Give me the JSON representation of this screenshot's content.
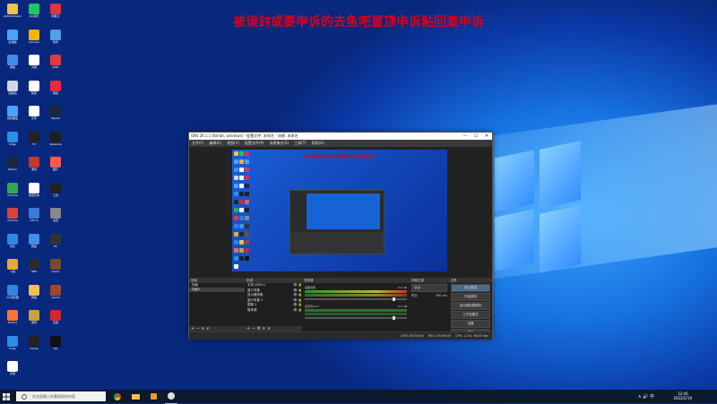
{
  "desktop": {
    "banner_text": "被误封或要申诉的去鱼吧置顶申诉贴回复申诉"
  },
  "desktop_icons": [
    {
      "label": "Administrator",
      "color": "#f2c14e"
    },
    {
      "label": "QQ音乐",
      "color": "#1ec760"
    },
    {
      "label": "网易云",
      "color": "#d9363e"
    },
    {
      "label": "此电脑",
      "color": "#4aa3ff"
    },
    {
      "label": "Chrome",
      "color": "#f4b400"
    },
    {
      "label": "软件",
      "color": "#53a0e8"
    },
    {
      "label": "网络",
      "color": "#3f8ee8"
    },
    {
      "label": "文档",
      "color": "#ffffff"
    },
    {
      "label": "WPS",
      "color": "#e03b3b"
    },
    {
      "label": "回收站",
      "color": "#cfd8e3"
    },
    {
      "label": "新建",
      "color": "#ffffff"
    },
    {
      "label": "网易",
      "color": "#e8283c"
    },
    {
      "label": "控制面板",
      "color": "#4aa3ff"
    },
    {
      "label": "文件",
      "color": "#ffffff"
    },
    {
      "label": "Steam",
      "color": "#1b2838"
    },
    {
      "label": "Edge",
      "color": "#2c8fe6"
    },
    {
      "label": "TV",
      "color": "#222222"
    },
    {
      "label": "WeGame",
      "color": "#1f1f1f"
    },
    {
      "label": "Steam",
      "color": "#1b2838"
    },
    {
      "label": "游戏",
      "color": "#c0392b"
    },
    {
      "label": "图片",
      "color": "#ff5a4a"
    },
    {
      "label": "Chrome",
      "color": "#34a853"
    },
    {
      "label": "新建文本",
      "color": "#ffffff"
    },
    {
      "label": "工具",
      "color": "#222222"
    },
    {
      "label": "Chrome",
      "color": "#db4437"
    },
    {
      "label": "CPU-Z",
      "color": "#3a7bd5"
    },
    {
      "label": "设置",
      "color": "#888888"
    },
    {
      "label": "优化",
      "color": "#2f86e0"
    },
    {
      "label": "网络",
      "color": "#3f8ee8"
    },
    {
      "label": "PC",
      "color": "#333333"
    },
    {
      "label": "斗鱼",
      "color": "#e8aa2a"
    },
    {
      "label": "OBS",
      "color": "#2a2a2a"
    },
    {
      "label": "Game",
      "color": "#7a4a2a"
    },
    {
      "label": "QQ浏览器",
      "color": "#2f86e0"
    },
    {
      "label": "网盘",
      "color": "#f2c14e"
    },
    {
      "label": "Game",
      "color": "#a1462a"
    },
    {
      "label": "FireFox",
      "color": "#ff7139"
    },
    {
      "label": "游戏",
      "color": "#c8a040"
    },
    {
      "label": "应用",
      "color": "#d0282e"
    },
    {
      "label": "Edge",
      "color": "#2c8fe6"
    },
    {
      "label": "Game",
      "color": "#222222"
    },
    {
      "label": "QQ",
      "color": "#111111"
    },
    {
      "label": "文档",
      "color": "#ffffff"
    }
  ],
  "obs": {
    "title": "OBS 26.1.1 (64-bit, windows) - 配置文件: 未命名 - 场景: 未命名",
    "window_buttons": [
      "—",
      "☐",
      "✕"
    ],
    "menu": [
      "文件(F)",
      "编辑(E)",
      "视图(V)",
      "配置文件(P)",
      "场景集合(S)",
      "工具(T)",
      "帮助(H)"
    ],
    "preview_banner": "被误封或要申诉的去鱼吧置顶申诉贴回复申诉",
    "scenes_header": "场景",
    "scenes": [
      "场景",
      "场景2"
    ],
    "sources_header": "来源",
    "sources": [
      {
        "name": "文本 (GDI+)",
        "vis": "👁 🔒"
      },
      {
        "name": "窗口采集",
        "vis": "👁 🔒"
      },
      {
        "name": "显示器采集",
        "vis": "👁 🔒"
      },
      {
        "name": "窗口采集 2",
        "vis": "👁 🔒"
      },
      {
        "name": "图像 2",
        "vis": "👁 🔒"
      },
      {
        "name": "媒体源",
        "vis": "👁 🔒"
      }
    ],
    "mixer_header": "混音器",
    "tracks": [
      {
        "name": "桌面音频",
        "level": "0.0 dB"
      },
      {
        "name": "麦克风/Aux",
        "level": "0.0 dB"
      }
    ],
    "transitions_header": "场景过渡",
    "transition_value": "淡出",
    "duration_label": "时长",
    "duration_value": "300 ms",
    "controls_header": "控件",
    "controls": [
      "停止推流",
      "开始录制",
      "启动虚拟摄像机",
      "工作室模式",
      "设置",
      "退出"
    ],
    "status": [
      "LIVE: 00:00:00",
      "REC: 00:00:00",
      "CPU: 2.1%, 60.00 fps"
    ]
  },
  "taskbar": {
    "search_placeholder": "在这里输入你要搜索的内容",
    "clock_time": "12:40",
    "clock_date": "2022/2/19",
    "tray_icons": "∧  🔊  中"
  }
}
